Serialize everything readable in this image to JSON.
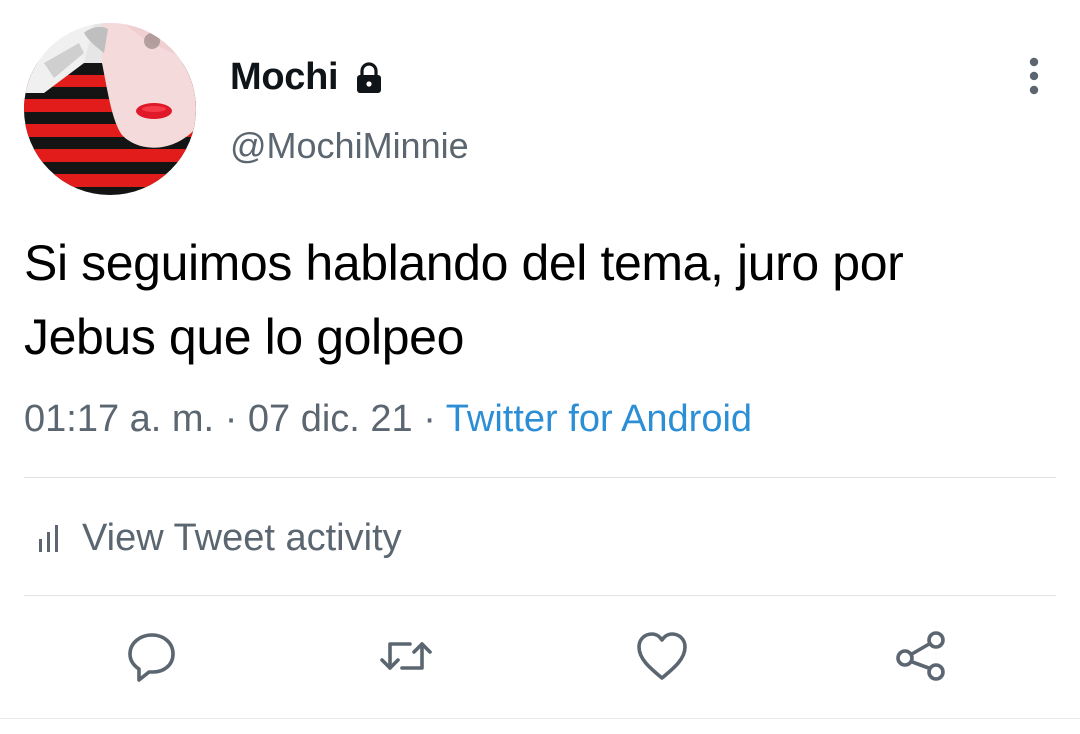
{
  "tweet": {
    "display_name": "Mochi",
    "handle": "@MochiMinnie",
    "text_line1": "Si seguimos hablando del tema, juro por",
    "text_line2": "Jebus que lo golpeo",
    "time": "01:17 a. m.",
    "separator": "·",
    "date": "07 dic. 21",
    "source": "Twitter for Android"
  },
  "activity": {
    "label": "View Tweet activity"
  },
  "icons": {
    "lock": "lock-icon",
    "more": "more-vertical-icon",
    "activity": "bar-chart-icon",
    "reply": "reply-icon",
    "retweet": "retweet-icon",
    "like": "heart-icon",
    "share": "share-icon"
  },
  "colors": {
    "link": "#2c8fd6",
    "secondary_text": "#5b6670",
    "primary_text": "#000000",
    "divider": "#dfe3e6"
  }
}
